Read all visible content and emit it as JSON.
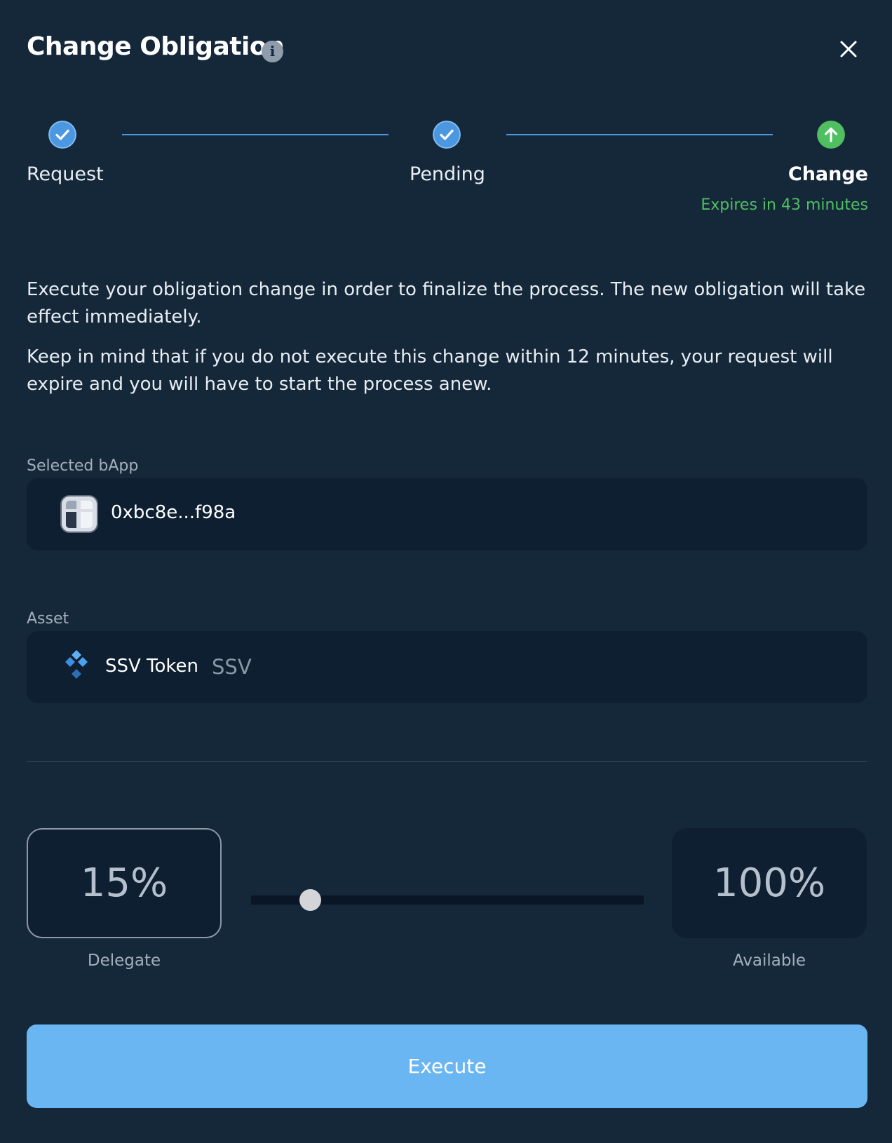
{
  "modal": {
    "title": "Change Obligation"
  },
  "steps": [
    {
      "label": "Request",
      "status": "complete"
    },
    {
      "label": "Pending",
      "status": "complete"
    },
    {
      "label": "Change",
      "status": "active"
    }
  ],
  "expires_text": "Expires in 43 minutes",
  "description": [
    "Execute your obligation change in order to finalize the process. The new obligation will take effect immediately.",
    "Keep in mind that if you do not execute this change within 12 minutes, your request will expire and you will have to start the process anew."
  ],
  "bapp": {
    "label": "Selected bApp",
    "address": "0xbc8e...f98a"
  },
  "asset": {
    "label": "Asset",
    "name": "SSV Token",
    "symbol": "SSV"
  },
  "obligation": {
    "delegate_value": "15%",
    "delegate_label": "Delegate",
    "available_value": "100%",
    "available_label": "Available",
    "slider_fraction": 0.15
  },
  "actions": {
    "execute_label": "Execute"
  },
  "colors": {
    "background": "#15283a",
    "field_background": "#0e1f31",
    "accent_blue": "#4c97e2",
    "success_green": "#4fbf60",
    "button_blue": "#6ab6f2"
  },
  "icons": {
    "title_info": "info-icon",
    "close": "close-icon",
    "step_complete": "check-circle-icon",
    "step_active": "arrow-up-circle-icon",
    "bapp": "bapp-logo-icon",
    "asset": "ssv-token-icon"
  }
}
